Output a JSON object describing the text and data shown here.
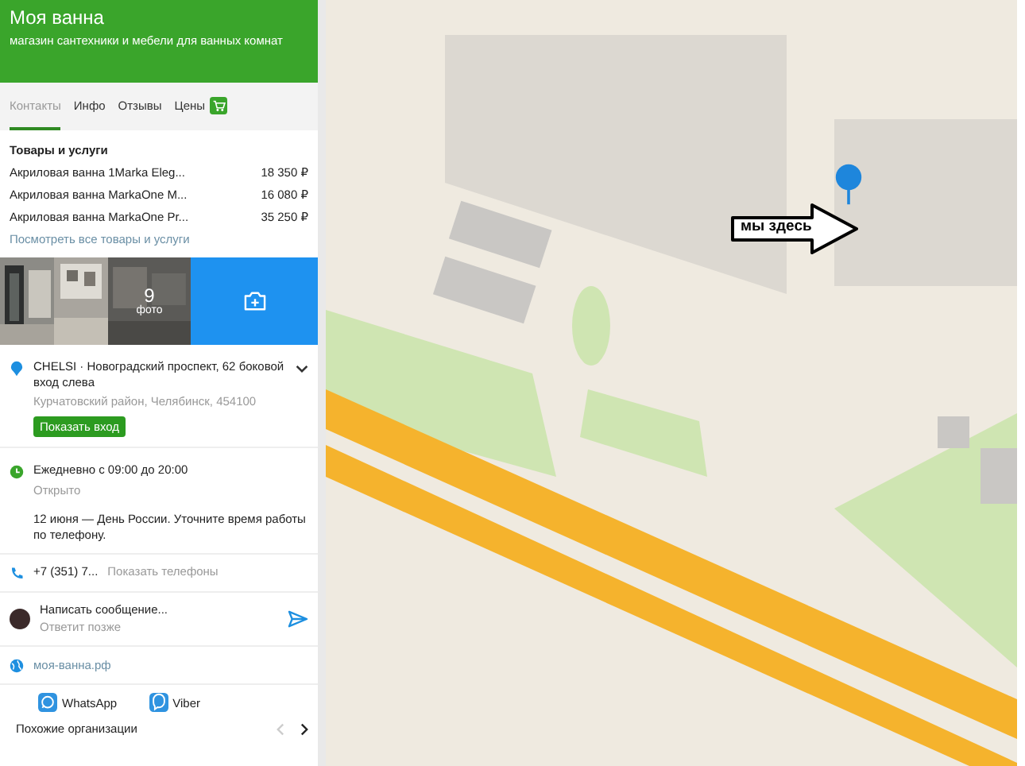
{
  "header": {
    "title": "Моя ванна",
    "subtitle": "магазин сантехники и мебели для ванных комнат"
  },
  "tabs": [
    {
      "label": "Контакты",
      "selected": true,
      "badge": false
    },
    {
      "label": "Инфо",
      "selected": false,
      "badge": false
    },
    {
      "label": "Отзывы",
      "selected": false,
      "badge": false
    },
    {
      "label": "Цены",
      "selected": false,
      "badge": true
    }
  ],
  "products": {
    "title": "Товары и услуги",
    "items": [
      {
        "name": "Акриловая ванна 1Marka Eleg...",
        "price": "18 350 ₽"
      },
      {
        "name": "Акриловая ванна MarkaOne M...",
        "price": "16 080 ₽"
      },
      {
        "name": "Акриловая ванна MarkaOne Pr...",
        "price": "35 250 ₽"
      }
    ],
    "link": "Посмотреть все товары и услуги"
  },
  "photos": {
    "count": "9",
    "label": "фото"
  },
  "address": {
    "line": "CHELSI · Новоградский проспект, 62 боковой вход слева",
    "district": "Курчатовский район, Челябинск, 454100",
    "button": "Показать вход"
  },
  "hours": {
    "schedule": "Ежедневно с 09:00 до 20:00",
    "status": "Открыто",
    "note": "12 июня — День России. Уточните время работы по телефону."
  },
  "phone": {
    "number": "+7 (351) 7...",
    "action": "Показать телефоны"
  },
  "message": {
    "text": "Написать сообщение...",
    "note": "Ответит позже"
  },
  "website": "моя-ванна.рф",
  "messengers": [
    {
      "kind": "whatsapp",
      "label": "WhatsApp"
    },
    {
      "kind": "viber",
      "label": "Viber"
    }
  ],
  "similar": {
    "label": "Похожие организации"
  },
  "map": {
    "callout": "мы здесь"
  }
}
